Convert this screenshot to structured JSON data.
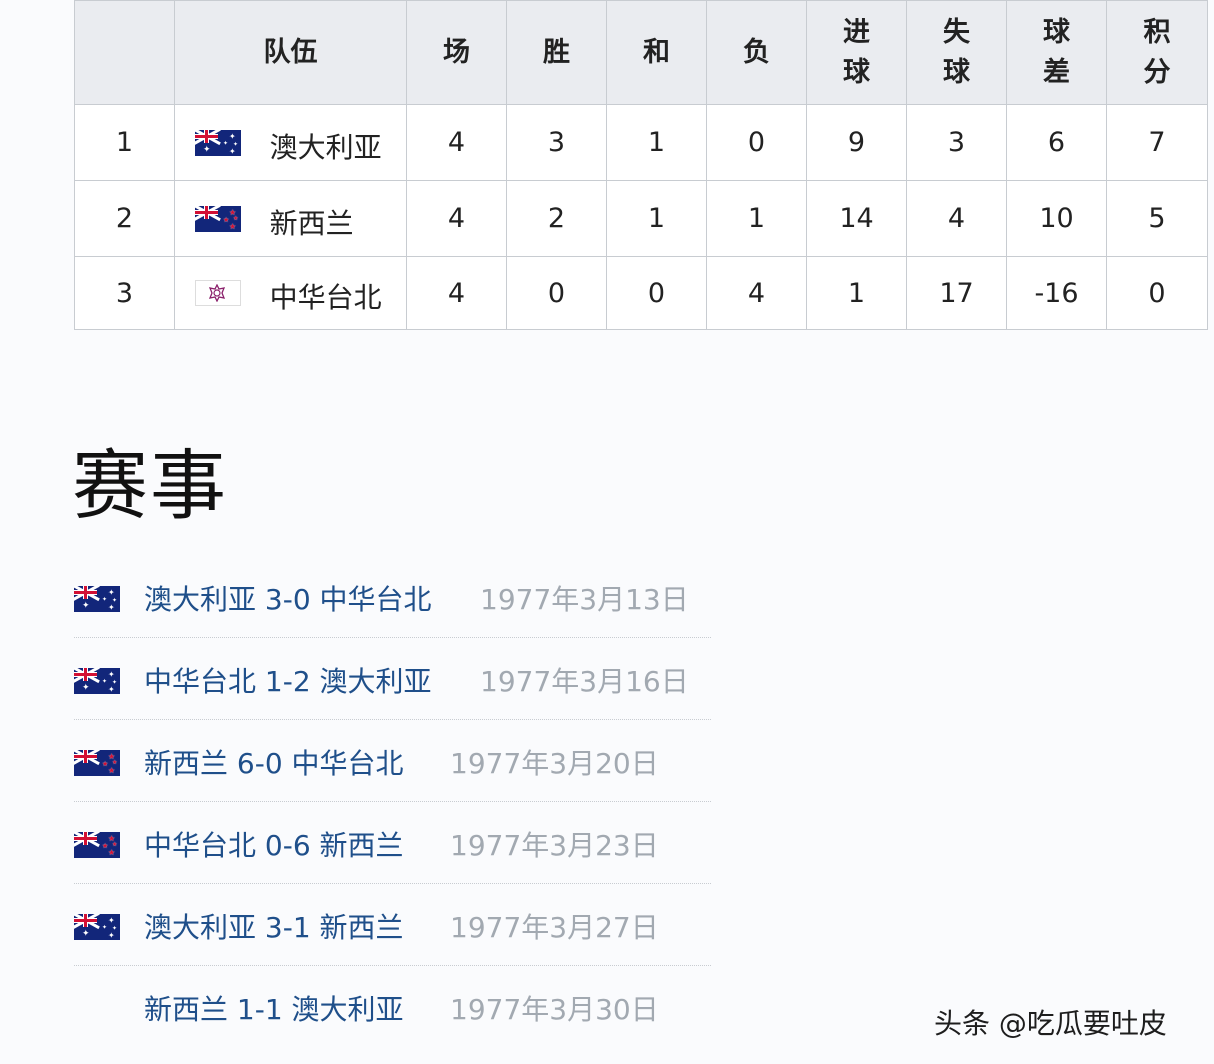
{
  "standings": {
    "headers": {
      "rank": "",
      "team": "队伍",
      "played": "场",
      "won": "胜",
      "drawn": "和",
      "lost": "负",
      "goals_for": [
        "进",
        "球"
      ],
      "goals_against": [
        "失",
        "球"
      ],
      "goal_diff": [
        "球",
        "差"
      ],
      "points": [
        "积",
        "分"
      ]
    },
    "rows": [
      {
        "rank": "1",
        "team": "澳大利亚",
        "flag": "australia-flag",
        "played": "4",
        "won": "3",
        "drawn": "1",
        "lost": "0",
        "gf": "9",
        "ga": "3",
        "gd": "6",
        "pts": "7"
      },
      {
        "rank": "2",
        "team": "新西兰",
        "flag": "new-zealand-flag",
        "played": "4",
        "won": "2",
        "drawn": "1",
        "lost": "1",
        "gf": "14",
        "ga": "4",
        "gd": "10",
        "pts": "5"
      },
      {
        "rank": "3",
        "team": "中华台北",
        "flag": "chinese-taipei-flag",
        "played": "4",
        "won": "0",
        "drawn": "0",
        "lost": "4",
        "gf": "1",
        "ga": "17",
        "gd": "-16",
        "pts": "0"
      }
    ]
  },
  "section_title": "赛事",
  "matches": [
    {
      "flag": "australia-flag",
      "text": "澳大利亚 3-0 中华台北",
      "date": "1977年3月13日"
    },
    {
      "flag": "australia-flag",
      "text": "中华台北 1-2 澳大利亚",
      "date": "1977年3月16日"
    },
    {
      "flag": "new-zealand-flag",
      "text": "新西兰 6-0 中华台北",
      "date": "1977年3月20日"
    },
    {
      "flag": "new-zealand-flag",
      "text": "中华台北 0-6 新西兰",
      "date": "1977年3月23日"
    },
    {
      "flag": "australia-flag",
      "text": "澳大利亚 3-1 新西兰",
      "date": "1977年3月27日"
    },
    {
      "flag": "",
      "text": "新西兰 1-1 澳大利亚",
      "date": "1977年3月30日"
    }
  ],
  "watermark": "头条 @吃瓜要吐皮",
  "colors": {
    "link": "#1f4f8a",
    "date": "#a2a9b1",
    "header_bg": "#eaecf0",
    "border": "#c8ccd1",
    "flag_blue": "#12267a",
    "flag_red": "#d21034"
  }
}
